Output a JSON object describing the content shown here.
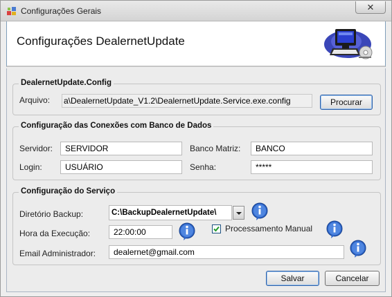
{
  "window": {
    "title": "Configurações Gerais",
    "close_symbol": "✕"
  },
  "header": {
    "title": "Configurações DealernetUpdate",
    "art_icon": "computer-settings-icon"
  },
  "config_group": {
    "legend": "DealernetUpdate.Config",
    "arquivo_label": "Arquivo:",
    "arquivo_value": "a\\DealernetUpdate_V1.2\\DealernetUpdate.Service.exe.config",
    "browse_label": "Procurar"
  },
  "db_group": {
    "legend": "Configuração das Conexões com Banco de Dados",
    "servidor_label": "Servidor:",
    "servidor_value": "SERVIDOR",
    "banco_label": "Banco Matriz:",
    "banco_value": "BANCO",
    "login_label": "Login:",
    "login_value": "USUÁRIO",
    "senha_label": "Senha:",
    "senha_value": "*****"
  },
  "service_group": {
    "legend": "Configuração do Serviço",
    "diretorio_label": "Diretório Backup:",
    "diretorio_value": "C:\\BackupDealernetUpdate\\",
    "hora_label": "Hora da Execução:",
    "hora_value": "22:00:00",
    "manual_label": "Processamento Manual",
    "manual_checked": true,
    "email_label": "Email Administrador:",
    "email_value": "dealernet@gmail.com",
    "info_icon": "info-icon"
  },
  "footer": {
    "save_label": "Salvar",
    "cancel_label": "Cancelar"
  }
}
